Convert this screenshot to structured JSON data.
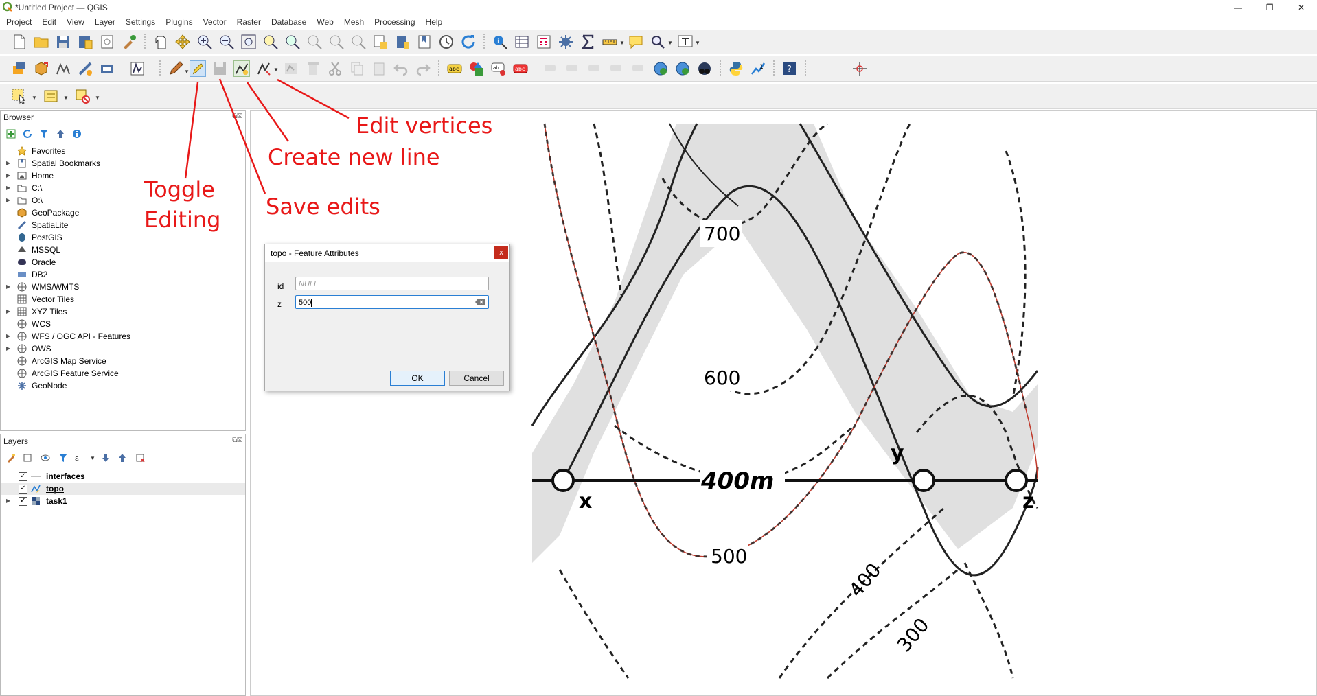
{
  "window": {
    "title": "*Untitled Project — QGIS",
    "minimize": "—",
    "restore": "❐",
    "close": "✕"
  },
  "menu": [
    "Project",
    "Edit",
    "View",
    "Layer",
    "Settings",
    "Plugins",
    "Vector",
    "Raster",
    "Database",
    "Web",
    "Mesh",
    "Processing",
    "Help"
  ],
  "browser": {
    "title": "Browser",
    "items": [
      {
        "label": "Favorites",
        "icon": "star-icon",
        "expandable": false
      },
      {
        "label": "Spatial Bookmarks",
        "icon": "bookmark-icon",
        "expandable": true
      },
      {
        "label": "Home",
        "icon": "home-folder-icon",
        "expandable": true
      },
      {
        "label": "C:\\",
        "icon": "folder-icon",
        "expandable": true
      },
      {
        "label": "O:\\",
        "icon": "folder-icon",
        "expandable": true
      },
      {
        "label": "GeoPackage",
        "icon": "geopackage-icon",
        "expandable": false
      },
      {
        "label": "SpatiaLite",
        "icon": "spatialite-icon",
        "expandable": false
      },
      {
        "label": "PostGIS",
        "icon": "postgis-icon",
        "expandable": false
      },
      {
        "label": "MSSQL",
        "icon": "mssql-icon",
        "expandable": false
      },
      {
        "label": "Oracle",
        "icon": "oracle-icon",
        "expandable": false
      },
      {
        "label": "DB2",
        "icon": "db2-icon",
        "expandable": false
      },
      {
        "label": "WMS/WMTS",
        "icon": "wms-icon",
        "expandable": true
      },
      {
        "label": "Vector Tiles",
        "icon": "vector-tiles-icon",
        "expandable": false
      },
      {
        "label": "XYZ Tiles",
        "icon": "xyz-tiles-icon",
        "expandable": true
      },
      {
        "label": "WCS",
        "icon": "wcs-icon",
        "expandable": false
      },
      {
        "label": "WFS / OGC API - Features",
        "icon": "wfs-icon",
        "expandable": true
      },
      {
        "label": "OWS",
        "icon": "ows-icon",
        "expandable": true
      },
      {
        "label": "ArcGIS Map Service",
        "icon": "arcgis-map-icon",
        "expandable": false
      },
      {
        "label": "ArcGIS Feature Service",
        "icon": "arcgis-feature-icon",
        "expandable": false
      },
      {
        "label": "GeoNode",
        "icon": "geonode-icon",
        "expandable": false
      }
    ]
  },
  "layers": {
    "title": "Layers",
    "items": [
      {
        "label": "interfaces",
        "icon": "line-layer-icon",
        "checked": true,
        "expandable": false,
        "underline": false
      },
      {
        "label": "topo",
        "icon": "line-layer-editing-icon",
        "checked": true,
        "expandable": false,
        "underline": true
      },
      {
        "label": "task1",
        "icon": "raster-layer-icon",
        "checked": true,
        "expandable": true,
        "underline": false
      }
    ]
  },
  "annotations": {
    "toggle_editing_1": "Toggle",
    "toggle_editing_2": "Editing",
    "save_edits": "Save edits",
    "create_new_line": "Create new line",
    "edit_vertices": "Edit vertices"
  },
  "dialog": {
    "title": "topo - Feature Attributes",
    "close": "x",
    "fields": [
      {
        "label": "id",
        "value": "",
        "placeholder": "NULL"
      },
      {
        "label": "z",
        "value": "500",
        "placeholder": ""
      }
    ],
    "ok": "OK",
    "cancel": "Cancel"
  },
  "map": {
    "contour_labels": [
      "700",
      "600",
      "500",
      "400",
      "300"
    ],
    "main_label": "400m",
    "points": [
      "x",
      "y",
      "z"
    ],
    "colors": {
      "digitized_line": "#c0392b",
      "fill": "#e0e0e0",
      "annotation": "#e81818"
    }
  }
}
